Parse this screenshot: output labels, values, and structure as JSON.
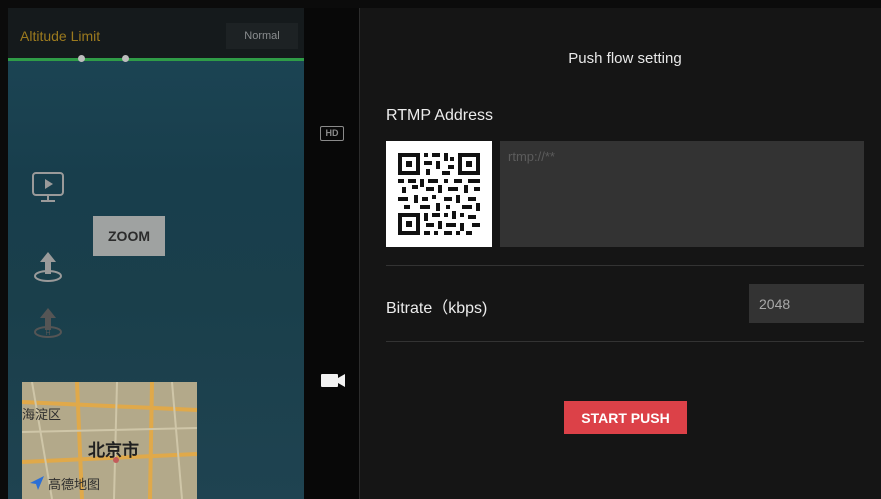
{
  "left_panel": {
    "altitude_title": "Altitude Limit",
    "altitude_mode": "Normal",
    "zoom_label": "ZOOM",
    "icons": [
      "play-screen-icon",
      "takeoff-icon",
      "return-home-icon"
    ],
    "map": {
      "district": "海淀区",
      "city": "北京市",
      "brand": "高德地图"
    }
  },
  "middle_strip": {
    "hd_badge": "HD",
    "icons": [
      "camera-icon"
    ]
  },
  "dialog": {
    "title": "Push flow setting",
    "rtmp_label": "RTMP Address",
    "rtmp_placeholder": "rtmp://**",
    "bitrate_label": "Bitrate（kbps)",
    "bitrate_value": "2048",
    "start_button": "START PUSH"
  },
  "colors": {
    "accent_red": "#dc4148",
    "altitude_bar_green": "#2f9c47",
    "altitude_title": "#9c7a1e",
    "dialog_bg": "#151515",
    "input_bg": "#333333"
  }
}
